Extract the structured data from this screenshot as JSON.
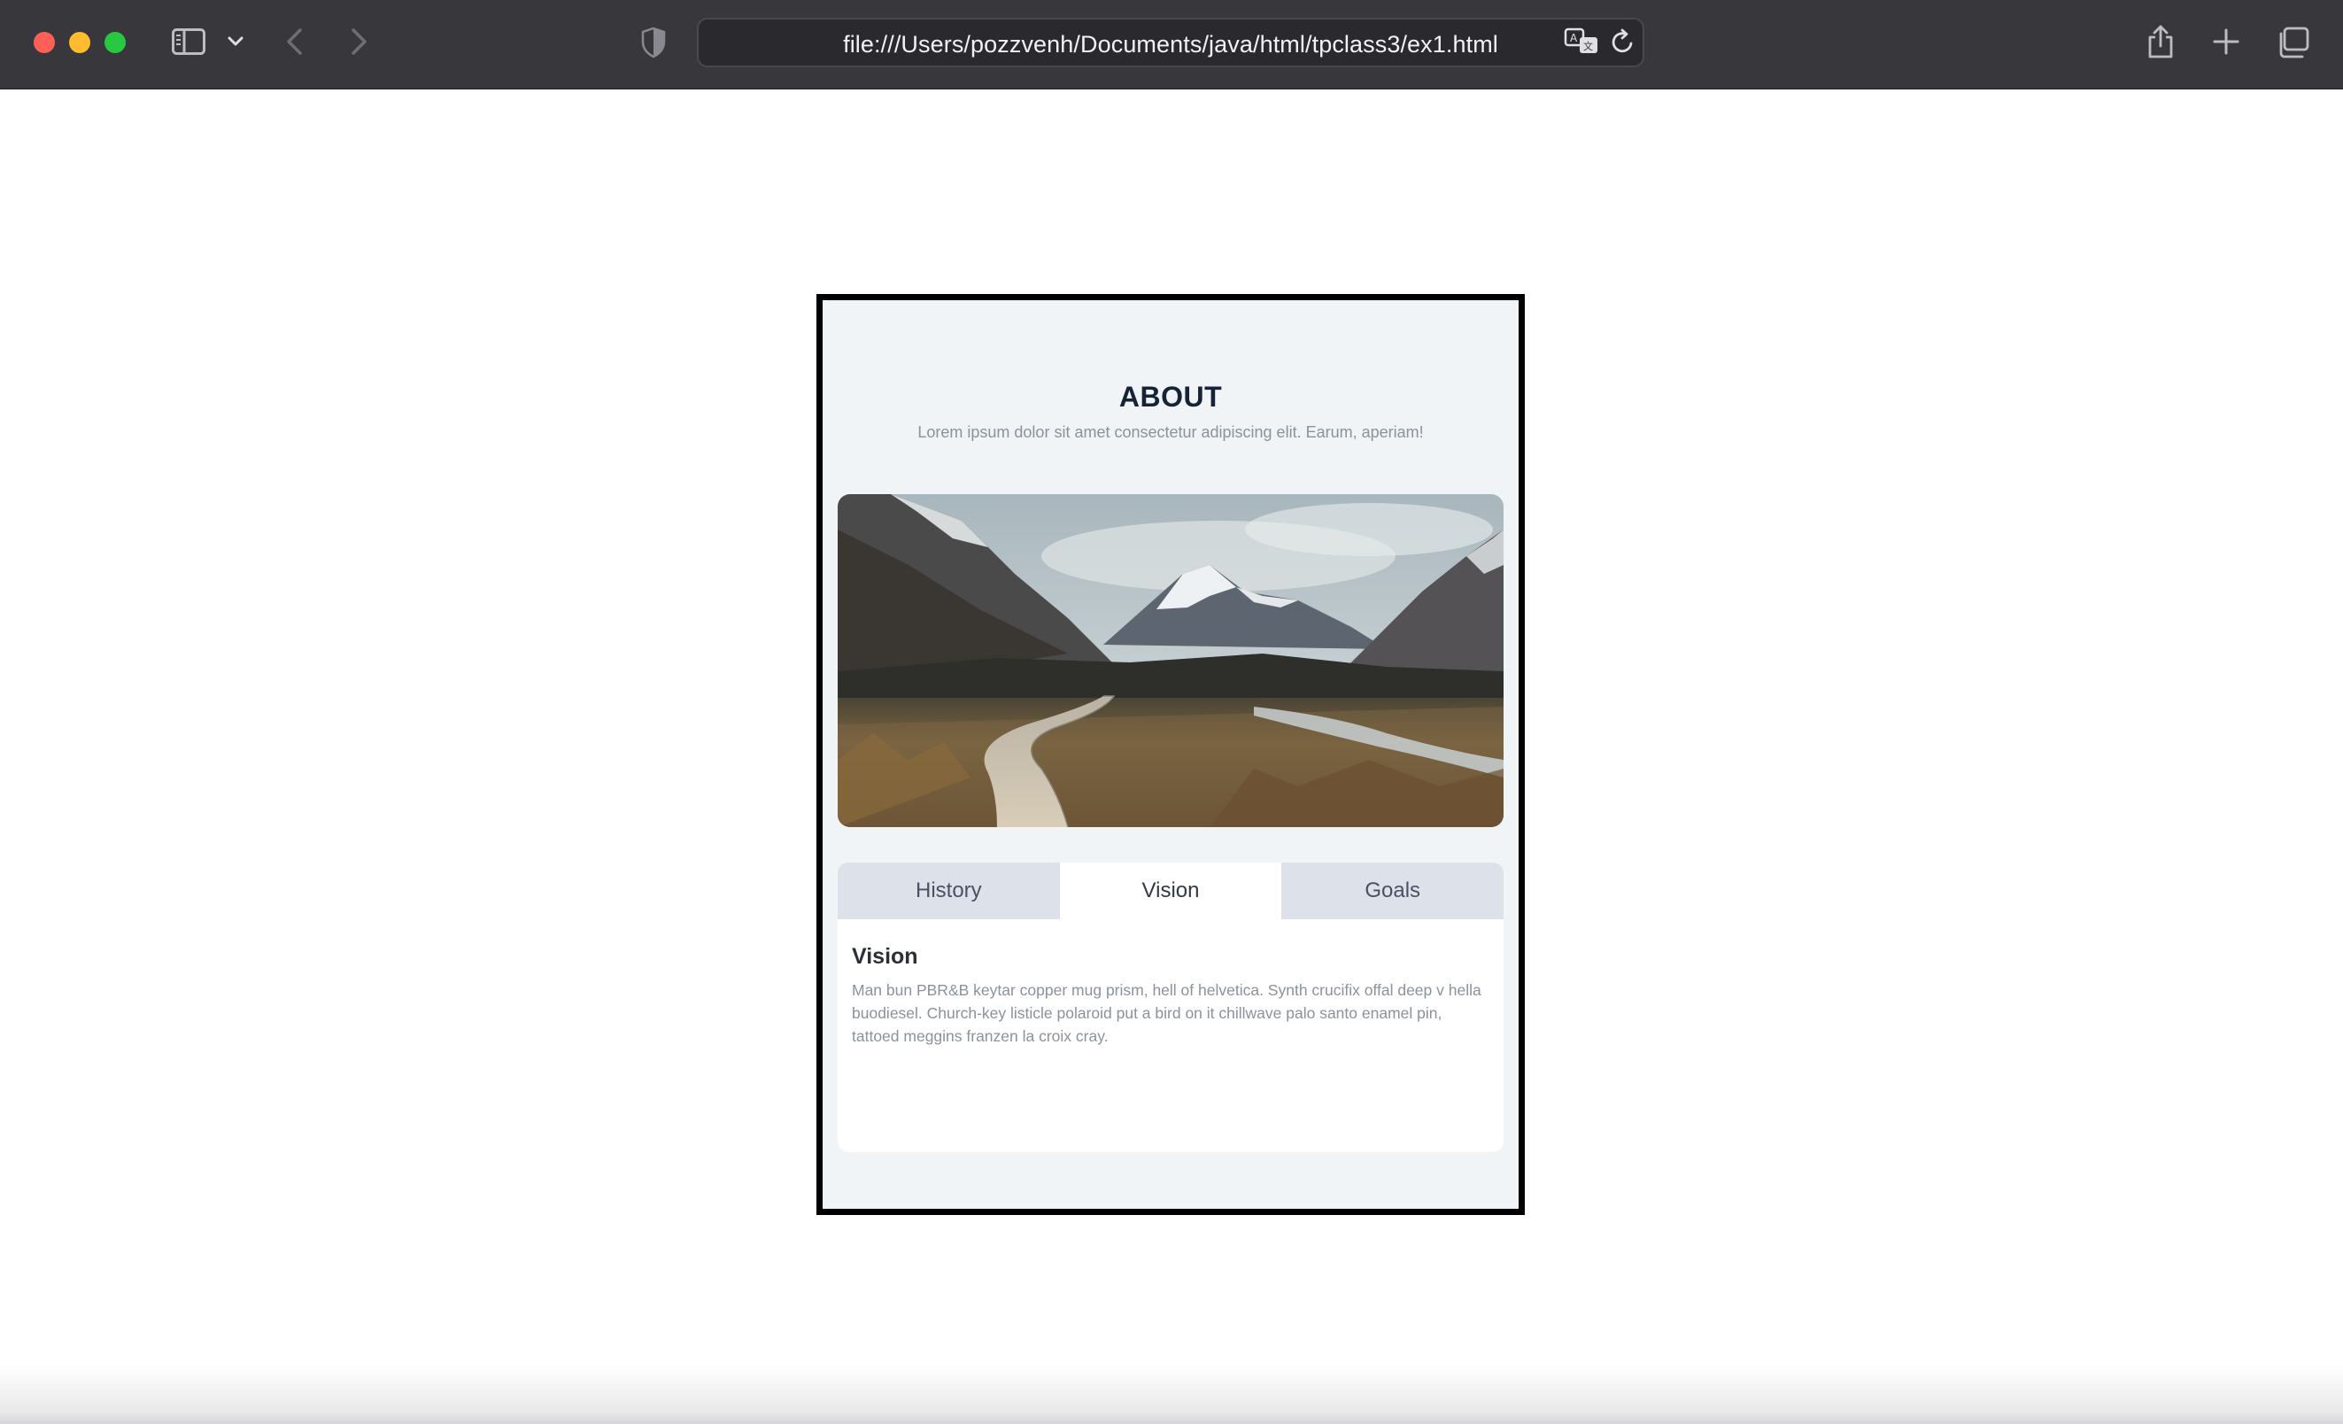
{
  "browser": {
    "url": "file:///Users/pozzvenh/Documents/java/html/tpclass3/ex1.html",
    "traffic_colors": {
      "close": "#ff5f57",
      "minimize": "#febc2e",
      "maximize": "#28c840"
    },
    "toolbar_icons": [
      "sidebar-icon",
      "chevron-down-icon",
      "back-icon",
      "forward-icon",
      "shield-icon",
      "translate-icon",
      "reload-icon",
      "share-icon",
      "plus-icon",
      "tabs-overview-icon"
    ]
  },
  "about": {
    "title": "ABOUT",
    "subtitle": "Lorem ipsum dolor sit amet consectetur adipiscing elit. Earum, aperiam!"
  },
  "tabs": [
    {
      "label": "History",
      "active": false
    },
    {
      "label": "Vision",
      "active": true
    },
    {
      "label": "Goals",
      "active": false
    }
  ],
  "panel": {
    "title": "Vision",
    "text": "Man bun PBR&B keytar copper mug prism, hell of helvetica. Synth crucifix offal deep v hella buodiesel. Church-key listicle polaroid put a bird on it chillwave palo santo enamel pin, tattoed meggins franzen la croix cray."
  },
  "colors": {
    "chrome_bg": "#38373c",
    "card_bg": "#f0f4f7",
    "card_border": "#000000",
    "tab_inactive": "#dde2ea",
    "tab_active": "#ffffff",
    "title_color": "#162235"
  }
}
